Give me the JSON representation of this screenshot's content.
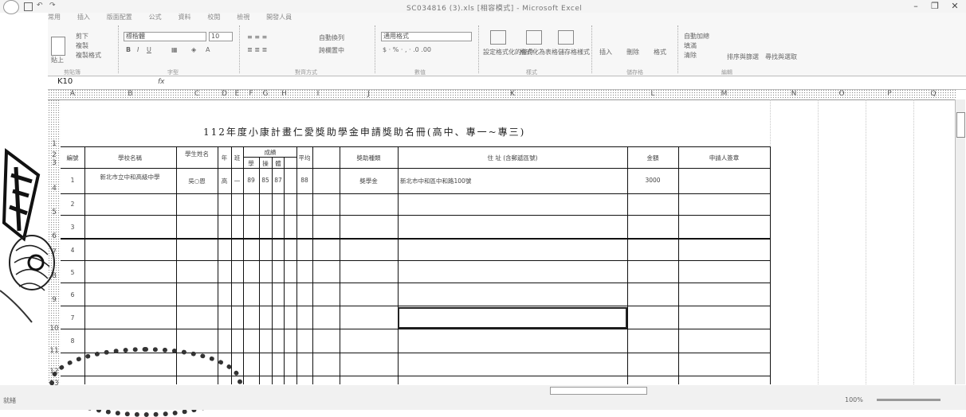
{
  "window": {
    "title": "SC034816 (3).xls [相容模式] - Microsoft Excel",
    "minimize": "–",
    "restore": "❐",
    "close": "✕"
  },
  "ribbon": {
    "tabs": [
      "常用",
      "插入",
      "版面配置",
      "公式",
      "資料",
      "校閱",
      "檢視",
      "開發人員"
    ],
    "clipboard": {
      "cut": "剪下",
      "copy": "複製",
      "paste": "貼上",
      "format_painter": "複製格式",
      "group": "剪貼簿"
    },
    "font": {
      "name": "標楷體",
      "size": "10",
      "group": "字型"
    },
    "alignment": {
      "wrap": "自動換列",
      "merge": "跨欄置中",
      "group": "對齊方式"
    },
    "number": {
      "format": "通用格式",
      "group": "數值"
    },
    "styles": {
      "conditional": "設定格式化的條件",
      "table": "格式化為表格",
      "cell": "儲存格樣式",
      "group": "樣式"
    },
    "cells": {
      "insert": "插入",
      "delete": "刪除",
      "format": "格式",
      "group": "儲存格"
    },
    "editing": {
      "autosum": "自動加總",
      "fill": "填滿",
      "clear": "清除",
      "sort": "排序與篩選",
      "find": "尋找與選取",
      "group": "編輯"
    }
  },
  "formula_bar": {
    "name_box": "K10",
    "fx": "fx",
    "value": ""
  },
  "columns": [
    "A",
    "B",
    "C",
    "D",
    "E",
    "F",
    "G",
    "H",
    "I",
    "J",
    "K",
    "L",
    "M",
    "N",
    "O",
    "P",
    "Q"
  ],
  "rows": [
    "1",
    "2",
    "3",
    "4",
    "5",
    "6",
    "7",
    "8",
    "9",
    "10",
    "11",
    "12",
    "13"
  ],
  "sheet": {
    "title": "112年度小康計畫仁愛獎助學金申請獎助名冊(高中、專一~專三)",
    "headers": {
      "no": "編號",
      "school": "學校名稱",
      "student": "學生姓名",
      "grade": "年",
      "class": "班",
      "score_group": "成績",
      "score_sub": [
        "學",
        "操",
        "體"
      ],
      "avg": "平均",
      "type": "獎助種類",
      "address": "住 址 (含郵遞區號)",
      "amount": "金額",
      "remark": "申請人簽章"
    },
    "rows": [
      {
        "no": "1",
        "school": "新北市立中和高級中學",
        "student": "吳○恩",
        "grade": "高",
        "class": "一",
        "s1": "89",
        "s2": "85",
        "s3": "87",
        "avg": "88",
        "type": "獎學金",
        "address": "新北市中和區中和路100號",
        "amount": "3000",
        "remark": ""
      },
      {
        "no": "2"
      },
      {
        "no": "3"
      },
      {
        "no": "4"
      },
      {
        "no": "5"
      },
      {
        "no": "6"
      },
      {
        "no": "7"
      },
      {
        "no": "8"
      }
    ]
  },
  "status": {
    "ready": "就緒",
    "zoom": "100%"
  }
}
